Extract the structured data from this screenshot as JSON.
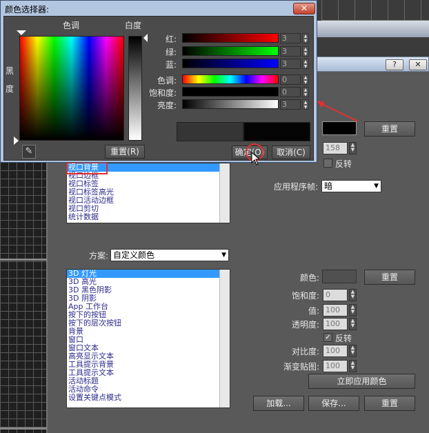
{
  "dialog": {
    "title": "颜色选择器:",
    "close_label": "✕",
    "hue_label": "色调",
    "white_label": "白度",
    "black_label": "黑",
    "degree_label": "度",
    "sliders": [
      {
        "label": "红:",
        "value": "3"
      },
      {
        "label": "绿:",
        "value": "3"
      },
      {
        "label": "蓝:",
        "value": "3"
      },
      {
        "label": "色调:",
        "value": "0"
      },
      {
        "label": "饱和度:",
        "value": "0"
      },
      {
        "label": "亮度:",
        "value": "3"
      }
    ],
    "reset_label": "重置(R)",
    "ok_label": "确定(O)",
    "cancel_label": "取消(C)"
  },
  "prefs": {
    "help_label": "?",
    "close_label": "✕",
    "reset_label": "重置",
    "spin_value": "158",
    "invert_label": "反转",
    "app_frame_label": "应用程序帧:",
    "app_frame_value": "暗",
    "top_list": [
      "视口背景",
      "视口边框",
      "视口标签",
      "视口标签高光",
      "视口活动边框",
      "视口剪切",
      "统计数据"
    ],
    "scheme_label": "方案:",
    "scheme_value": "自定义颜色",
    "bottom_list": [
      "3D 灯光",
      "3D 高光",
      "3D 黑色阴影",
      "3D 阴影",
      "App 工作台",
      "按下的按钮",
      "按下的层次按钮",
      "背景",
      "窗口",
      "窗口文本",
      "高亮显示文本",
      "工具提示背景",
      "工具提示文本",
      "活动标题",
      "活动命令",
      "设置关键点模式"
    ],
    "color_label": "颜色:",
    "saturation_label": "饱和度:",
    "value_label": "值:",
    "transparency_label": "透明度:",
    "saturation_value": "0",
    "value_value": "100",
    "transparency_value": "100",
    "invert2_label": "反转",
    "contrast_label": "对比度:",
    "contrast_value": "100",
    "gradient_label": "渐变贴图:",
    "gradient_value": "100",
    "apply_label": "立即应用颜色",
    "load_label": "加载...",
    "save_label": "保存...",
    "reset2_label": "重置"
  },
  "colors": {
    "accent": "#3399ff",
    "highlight": "#e03030"
  }
}
